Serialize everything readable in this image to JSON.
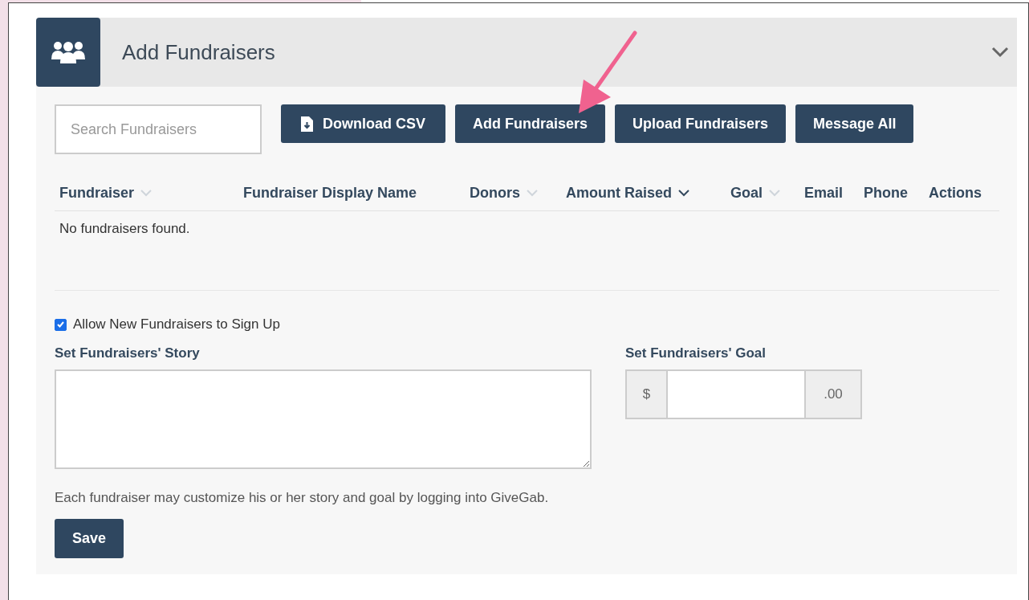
{
  "panel": {
    "title": "Add Fundraisers",
    "expanded": true
  },
  "search": {
    "placeholder": "Search Fundraisers"
  },
  "buttons": [
    {
      "label": "Download CSV",
      "kind": "download"
    },
    {
      "label": "Add Fundraisers",
      "kind": "plain"
    },
    {
      "label": "Upload Fundraisers",
      "kind": "plain"
    },
    {
      "label": "Message All",
      "kind": "plain"
    }
  ],
  "table": {
    "columns": [
      {
        "label": "Fundraiser",
        "sortable": true,
        "sorted": false
      },
      {
        "label": "Fundraiser Display Name",
        "sortable": false
      },
      {
        "label": "Donors",
        "sortable": true,
        "sorted": false
      },
      {
        "label": "Amount Raised",
        "sortable": true,
        "sorted": true
      },
      {
        "label": "Goal",
        "sortable": true,
        "sorted": false
      },
      {
        "label": "Email",
        "sortable": false
      },
      {
        "label": "Phone",
        "sortable": false
      },
      {
        "label": "Actions",
        "sortable": false
      }
    ],
    "empty_message": "No fundraisers found."
  },
  "allow_signup": {
    "label": "Allow New Fundraisers to Sign Up",
    "checked": true
  },
  "story": {
    "label": "Set Fundraisers' Story"
  },
  "goal": {
    "label": "Set Fundraisers' Goal",
    "prefix": "$",
    "suffix": ".00"
  },
  "help_text": "Each fundraiser may customize his or her story and goal by logging into GiveGab.",
  "save_button": {
    "label": "Save"
  }
}
